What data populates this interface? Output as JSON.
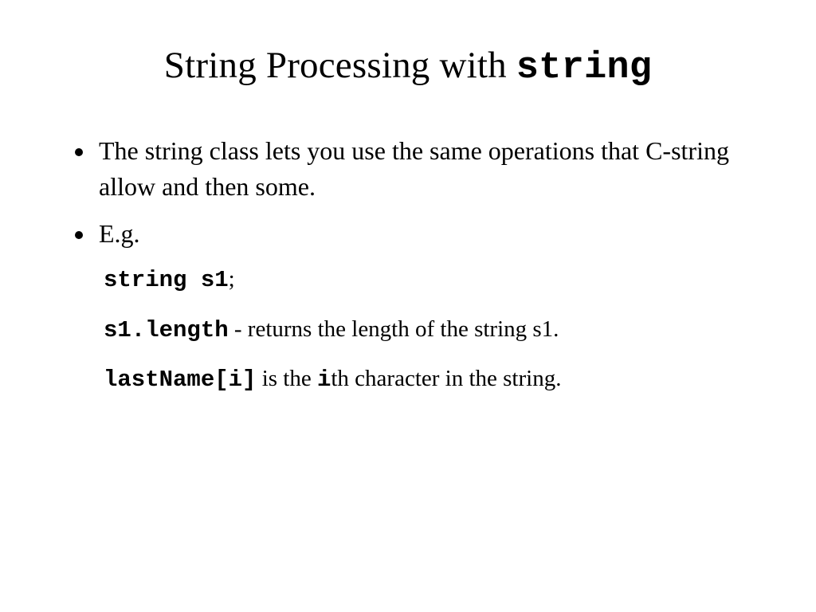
{
  "title": {
    "prefix": "String Processing with ",
    "code": "string"
  },
  "bullets": {
    "b0": "The string class lets you use the same operations that C-string allow and then some.",
    "b1": "E.g."
  },
  "sub": {
    "line0": {
      "code": "string s1",
      "tail": ";"
    },
    "line1": {
      "code": "s1.length",
      "tail": "  - returns the length of the string s1."
    },
    "line2": {
      "code0": "lastName[i]",
      "mid": " is the ",
      "code1": "i",
      "tail": "th character in the string."
    }
  }
}
